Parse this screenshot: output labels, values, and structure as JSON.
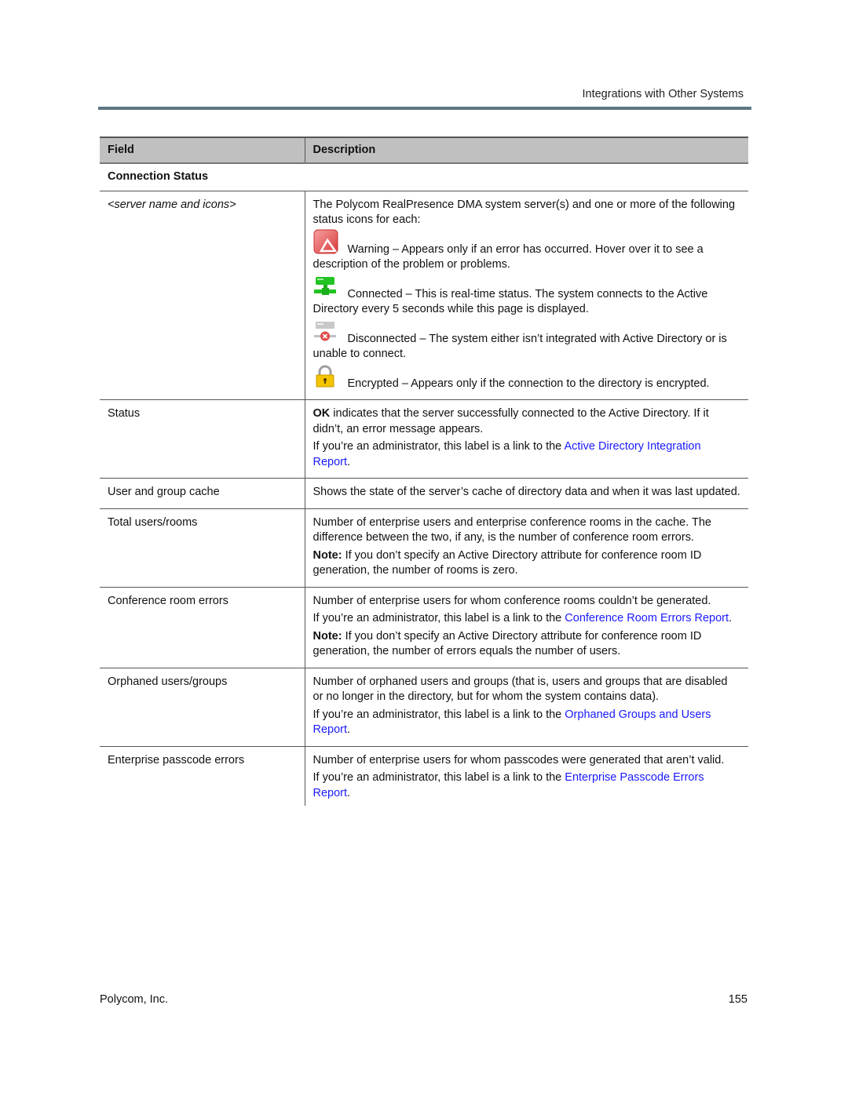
{
  "header": {
    "running_title": "Integrations with Other Systems"
  },
  "table": {
    "columns": [
      "Field",
      "Description"
    ],
    "section": "Connection Status",
    "rows": [
      {
        "field": "<server name and icons>",
        "intro": "The Polycom RealPresence DMA system server(s) and one or more of the following status icons for each:",
        "icons": [
          {
            "icon": "warning-icon",
            "text": "Warning – Appears only if an error has occurred. Hover over it to see a description of the problem or problems."
          },
          {
            "icon": "connected-icon",
            "text": "Connected – This is real-time status. The system connects to the Active Directory every 5 seconds while this page is displayed."
          },
          {
            "icon": "disconnected-icon",
            "text": "Disconnected – The system either isn’t integrated with Active Directory or is unable to connect."
          },
          {
            "icon": "encrypted-lock-icon",
            "text": "Encrypted – Appears only if the connection to the directory is encrypted."
          }
        ]
      },
      {
        "field": "Status",
        "p1_bold": "OK",
        "p1_rest": " indicates that the server successfully connected to the Active Directory. If it didn’t, an error message appears.",
        "p2_prefix": "If you’re an administrator, this label is a link to the ",
        "p2_link": "Active Directory Integration Report",
        "p2_suffix": "."
      },
      {
        "field": "User and group cache",
        "p1": "Shows the state of the server’s cache of directory data and when it was last updated."
      },
      {
        "field": "Total users/rooms",
        "p1": "Number of enterprise users and enterprise conference rooms in the cache. The difference between the two, if any, is the number of conference room errors.",
        "note_label": "Note:",
        "note_text": " If you don’t specify an Active Directory attribute for conference room ID generation, the number of rooms is zero."
      },
      {
        "field": "Conference room errors",
        "p1": "Number of enterprise users for whom conference rooms couldn’t be generated.",
        "p2_prefix": "If you’re an administrator, this label is a link to the ",
        "p2_link": "Conference Room Errors Report",
        "p2_suffix": ".",
        "note_label": "Note:",
        "note_text": " If you don’t specify an Active Directory attribute for conference room ID generation, the number of errors equals the number of users."
      },
      {
        "field": "Orphaned users/groups",
        "p1": "Number of orphaned users and groups (that is, users and groups that are disabled or no longer in the directory, but for whom the system contains data).",
        "p2_prefix": "If you’re an administrator, this label is a link to the ",
        "p2_link": "Orphaned Groups and Users Report",
        "p2_suffix": "."
      },
      {
        "field": "Enterprise passcode errors",
        "p1": "Number of enterprise users for whom passcodes were generated that aren’t valid.",
        "p2_prefix": "If you’re an administrator, this label is a link to the ",
        "p2_link": "Enterprise Passcode Errors Report",
        "p2_suffix": "."
      }
    ]
  },
  "footer": {
    "company": "Polycom, Inc.",
    "page_number": "155"
  },
  "colors": {
    "header_rule": "#5e7683",
    "table_header_bg": "#c0c0c0",
    "link": "#1a1aff"
  }
}
